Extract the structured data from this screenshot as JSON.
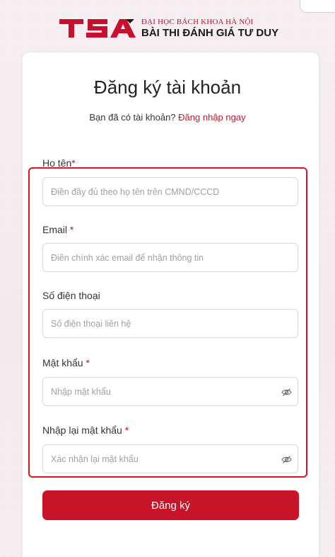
{
  "header": {
    "logo_text": "TSA",
    "line1": "ĐẠI HỌC BÁCH KHOA HÀ NỘI",
    "line2": "BÀI THI ĐÁNH GIÁ TƯ DUY",
    "brand_color": "#c8102e"
  },
  "form": {
    "title": "Đăng ký tài khoản",
    "have_account_text": "Bạn đã có tài khoản?",
    "login_link": "Đăng nhập ngay",
    "fields": [
      {
        "label": "Họ tên",
        "required_mark": "*",
        "placeholder": "Điền đầy đủ theo họ tên trên CMND/CCCD",
        "value": ""
      },
      {
        "label": "Email ",
        "required_mark": "*",
        "placeholder": "Điền chính xác email để nhận thông tin",
        "value": ""
      },
      {
        "label": "Số điện thoại",
        "required_mark": "",
        "placeholder": "Số điện thoại liên hệ",
        "value": ""
      },
      {
        "label": "Mật khẩu ",
        "required_mark": "*",
        "placeholder": "Nhập mật khẩu",
        "value": "",
        "icon": "eye-off-icon"
      },
      {
        "label": "Nhập lại mật khẩu ",
        "required_mark": "*",
        "placeholder": "Xác nhận lại mật khẩu",
        "value": "",
        "icon": "eye-off-icon"
      }
    ],
    "submit_label": "Đăng ký",
    "accent_color": "#c81428",
    "highlight_color": "#e0121f"
  }
}
